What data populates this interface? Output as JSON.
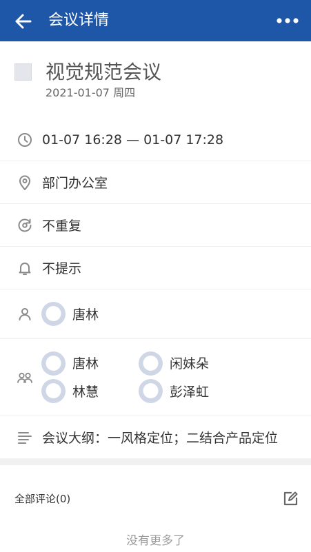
{
  "header": {
    "title": "会议详情",
    "back_icon": "arrow-left-icon",
    "more_icon": "more-dots-icon",
    "background": "#1e56a8"
  },
  "meeting": {
    "title": "视觉规范会议",
    "date": "2021-01-07 周四",
    "time_range": "01-07 16:28 — 01-07 17:28",
    "location": "部门办公室",
    "repeat": "不重复",
    "reminder": "不提示",
    "organizer": "唐林",
    "participants": [
      "唐林",
      "闲妹朵",
      "林慧",
      "彭泽虹"
    ],
    "outline": "会议大纲：一风格定位；二结合产品定位"
  },
  "comments": {
    "label": "全部评论(0)",
    "edit_icon": "edit-icon",
    "footer": "没有更多了"
  }
}
